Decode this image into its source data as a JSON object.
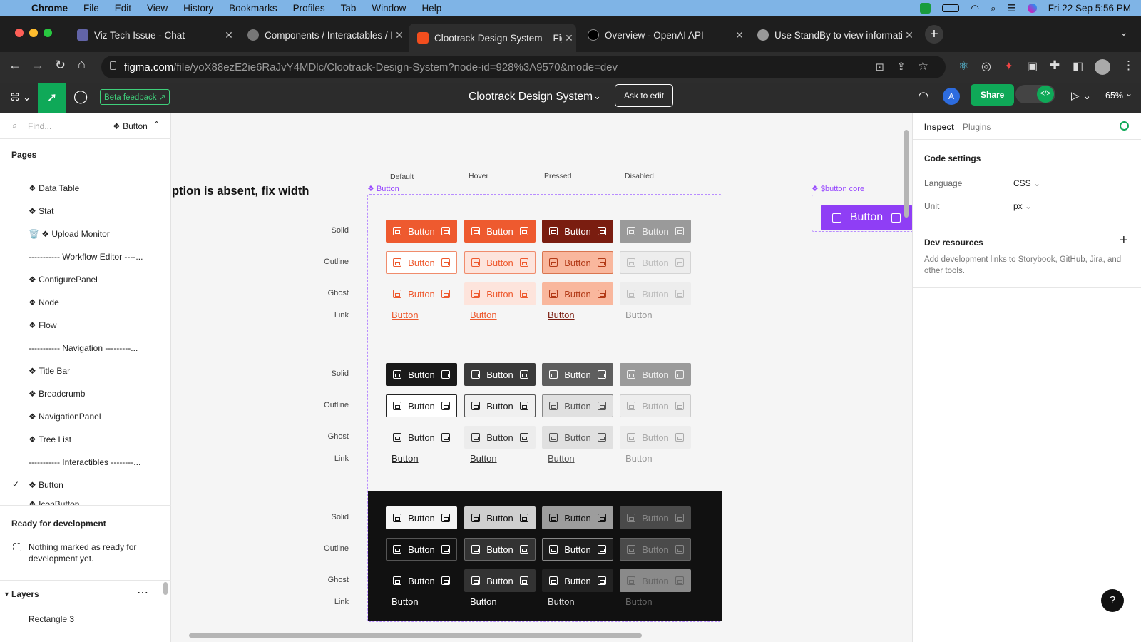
{
  "menubar": {
    "app": "Chrome",
    "items": [
      "File",
      "Edit",
      "View",
      "History",
      "Bookmarks",
      "Profiles",
      "Tab",
      "Window",
      "Help"
    ],
    "datetime": "Fri 22 Sep  5:56 PM"
  },
  "tabs": [
    {
      "title": "Viz Tech Issue - Chat",
      "color": "#6264a7"
    },
    {
      "title": "Components / Interactables / B",
      "color": "#888"
    },
    {
      "title": "Clootrack Design System – Fig",
      "color": "#f24e1e"
    },
    {
      "title": "Overview - OpenAI API",
      "color": "#222"
    },
    {
      "title": "Use StandBy to view informatio",
      "color": "#999"
    }
  ],
  "address": {
    "domain": "figma.com",
    "path": "/file/yoX88ezE2ie6RaJvY4MDlc/Clootrack-Design-System?node-id=928%3A9570&mode=dev"
  },
  "figma": {
    "beta": "Beta feedback",
    "file_title": "Clootrack Design System",
    "ask_edit": "Ask to edit",
    "avatar": "A",
    "share": "Share",
    "zoom": "65%"
  },
  "left": {
    "find_placeholder": "Find...",
    "current": "❖ Button",
    "pages_title": "Pages",
    "pages": [
      "❖ Data Table",
      "❖ Stat",
      "🗑️ ❖ Upload Monitor",
      "----------- Workflow Editor ----...",
      "❖ ConfigurePanel",
      "❖ Node",
      "❖ Flow",
      "----------- Navigation ---------...",
      "❖ Title Bar",
      "❖ Breadcrumb",
      "❖ NavigationPanel",
      "❖ Tree List",
      "----------- Interactibles --------...",
      "❖ Button",
      "❖ IconButton"
    ],
    "ready_title": "Ready for development",
    "ready_text": "Nothing marked as ready for development yet.",
    "layers_title": "Layers",
    "layer": "Rectangle 3"
  },
  "canvas": {
    "heading": "ption is absent, fix width",
    "component_label": "❖ Button",
    "core_label": "❖ $button core",
    "core_button": "Button",
    "columns": [
      "Default",
      "Hover",
      "Pressed",
      "Disabled"
    ],
    "rows": [
      "Solid",
      "Outline",
      "Ghost",
      "Link"
    ],
    "button_text": "Button"
  },
  "right": {
    "tab_inspect": "Inspect",
    "tab_plugins": "Plugins",
    "code_settings": "Code settings",
    "lang_label": "Language",
    "lang_val": "CSS",
    "unit_label": "Unit",
    "unit_val": "px",
    "dev_title": "Dev resources",
    "dev_text": "Add development links to Storybook, GitHub, Jira, and other tools.",
    "help": "?"
  }
}
